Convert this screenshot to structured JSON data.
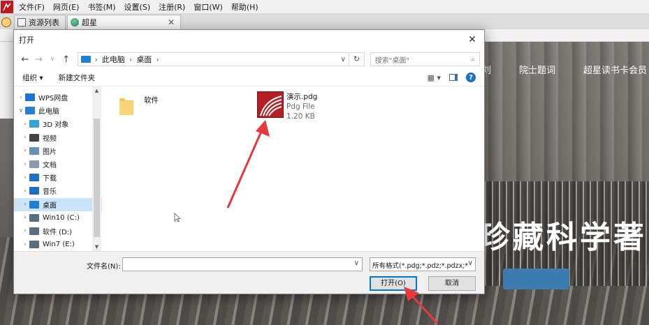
{
  "app": {
    "menu": [
      "文件(F)",
      "网页(E)",
      "书签(M)",
      "设置(S)",
      "注册(R)",
      "窗口(W)",
      "帮助(H)"
    ],
    "tabs": [
      {
        "label": "资源列表"
      },
      {
        "label": "超星"
      }
    ]
  },
  "background_site": {
    "nav": [
      "刘",
      "院士题词",
      "超星读书卡会员"
    ],
    "hero": "珍藏科学著"
  },
  "dialog": {
    "title": "打开",
    "breadcrumb": [
      "此电脑",
      "桌面"
    ],
    "search_placeholder": "搜索\"桌面\"",
    "toolbar": {
      "organize": "组织 ▾",
      "new_folder": "新建文件夹"
    },
    "nav_items": [
      {
        "label": "WPS网盘",
        "color": "#1e73d2",
        "expanded": false,
        "level": 0
      },
      {
        "label": "此电脑",
        "color": "#2a7fd4",
        "expanded": true,
        "level": 0
      },
      {
        "label": "3D 对象",
        "color": "#31a5d8",
        "level": 1
      },
      {
        "label": "视频",
        "color": "#444444",
        "level": 1
      },
      {
        "label": "图片",
        "color": "#6b8fb3",
        "level": 1
      },
      {
        "label": "文档",
        "color": "#8a9aaa",
        "level": 1
      },
      {
        "label": "下载",
        "color": "#1f6fc5",
        "level": 1
      },
      {
        "label": "音乐",
        "color": "#1f6fc5",
        "level": 1
      },
      {
        "label": "桌面",
        "color": "#1f7fd1",
        "level": 1,
        "selected": true
      },
      {
        "label": "Win10 (C:)",
        "color": "#5b6c7d",
        "level": 1
      },
      {
        "label": "软件 (D:)",
        "color": "#5b6c7d",
        "level": 1
      },
      {
        "label": "Win7 (E:)",
        "color": "#5b6c7d",
        "level": 1
      }
    ],
    "files": [
      {
        "name": "软件"
      },
      {
        "name": "演示.pdg",
        "type": "Pdg File",
        "size": "1.20 KB"
      }
    ],
    "filename_label": "文件名(N):",
    "filename_value": "",
    "filter": "所有格式(*.pdg;*.pdz;*.pdzx;*",
    "open_button": "打开(O)",
    "cancel_button": "取消"
  },
  "colors": {
    "annotation_arrow": "#e8383b",
    "accent": "#0078d7",
    "selected": "#cce4f7"
  }
}
